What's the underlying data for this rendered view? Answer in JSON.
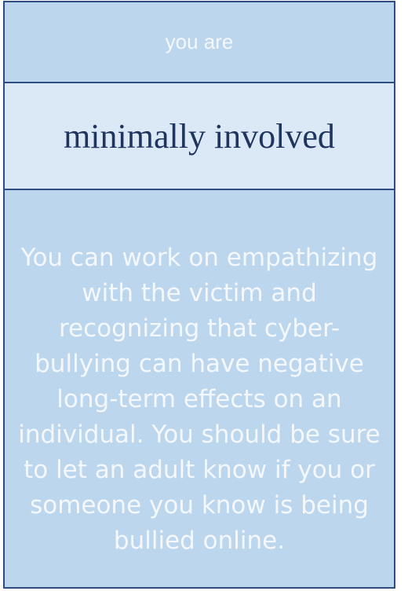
{
  "header": {
    "text": "you are"
  },
  "result": {
    "label": "minimally involved"
  },
  "advice": {
    "text": "You can work on empathizing with the victim and recognizing that cyber-bullying can have negative long-term effects on an individual. You should be sure to let an adult know if you or someone you know is being bullied online."
  },
  "colors": {
    "panel": "#bcd6ee",
    "highlight_band": "#dbe8f5",
    "border": "#2f4d82",
    "result_text": "#1f3560",
    "light_text": "#f4f8fc"
  }
}
